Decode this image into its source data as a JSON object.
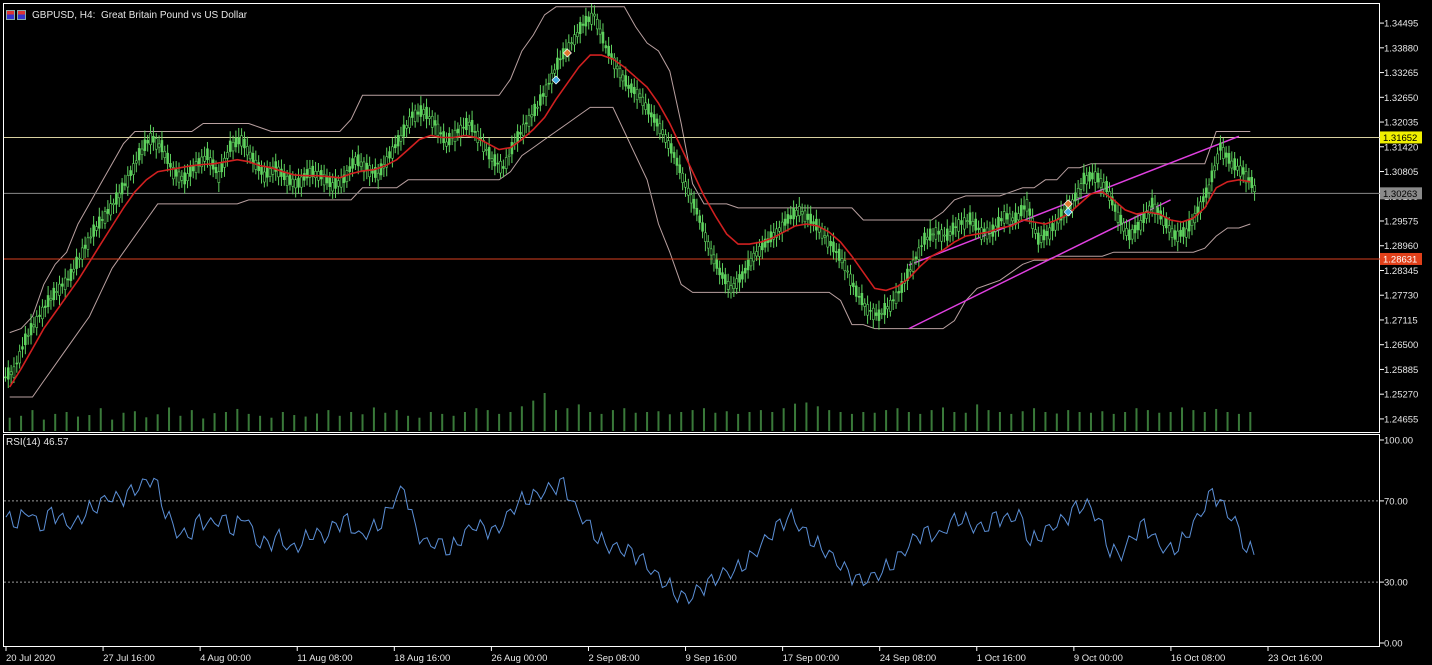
{
  "window": {
    "symbol": "GBPUSD",
    "timeframe": "H4",
    "description": "Great Britain Pound vs US Dollar",
    "icon_name": "chart-window-icon"
  },
  "colors": {
    "background": "#000000",
    "grid_frame": "#ffffff",
    "bull_candle": "#5fd35f",
    "bear_candle": "#5fd35f",
    "volume": "#3a7a3a",
    "ma": "#d02020",
    "channel": "#b9a0a0",
    "trendline": "#e040e0",
    "rsi": "#5b8fd6",
    "resistance": "#d8d0a0",
    "support": "#d84020",
    "current_price": "#8a8a8a"
  },
  "chart_data": {
    "type": "candlestick",
    "title": "GBPUSD, H4: Great Britain Pound vs US Dollar",
    "price_ticks": [
      "1.34495",
      "1.33880",
      "1.33265",
      "1.32650",
      "1.32035",
      "1.31420",
      "1.30805",
      "1.30190",
      "1.29575",
      "1.28960",
      "1.28345",
      "1.27730",
      "1.27115",
      "1.26500",
      "1.25885",
      "1.25270",
      "1.24655"
    ],
    "price_range": [
      1.2433,
      1.3487
    ],
    "time_labels": [
      "20 Jul 2020",
      "27 Jul 16:00",
      "4 Aug 00:00",
      "11 Aug 08:00",
      "18 Aug 16:00",
      "26 Aug 00:00",
      "2 Sep 08:00",
      "9 Sep 16:00",
      "17 Sep 00:00",
      "24 Sep 08:00",
      "1 Oct 16:00",
      "9 Oct 00:00",
      "16 Oct 08:00",
      "23 Oct 16:00"
    ],
    "close_series": [
      1.2585,
      1.266,
      1.271,
      1.2755,
      1.279,
      1.282,
      1.288,
      1.293,
      1.297,
      1.301,
      1.306,
      1.312,
      1.3165,
      1.314,
      1.308,
      1.306,
      1.3095,
      1.312,
      1.307,
      1.314,
      1.316,
      1.311,
      1.307,
      1.309,
      1.306,
      1.305,
      1.308,
      1.307,
      1.3045,
      1.306,
      1.311,
      1.309,
      1.307,
      1.312,
      1.3165,
      1.322,
      1.323,
      1.32,
      1.315,
      1.318,
      1.32,
      1.316,
      1.311,
      1.309,
      1.315,
      1.32,
      1.324,
      1.33,
      1.336,
      1.34,
      1.3445,
      1.347,
      1.339,
      1.334,
      1.329,
      1.327,
      1.322,
      1.318,
      1.312,
      1.305,
      1.298,
      1.29,
      1.283,
      1.279,
      1.282,
      1.287,
      1.29,
      1.293,
      1.296,
      1.2985,
      1.296,
      1.293,
      1.289,
      1.285,
      1.278,
      1.274,
      1.272,
      1.275,
      1.279,
      1.285,
      1.291,
      1.293,
      1.292,
      1.295,
      1.296,
      1.293,
      1.293,
      1.297,
      1.296,
      1.3,
      1.291,
      1.293,
      1.297,
      1.3,
      1.306,
      1.307,
      1.304,
      1.297,
      1.292,
      1.295,
      1.3,
      1.296,
      1.292,
      1.293,
      1.298,
      1.304,
      1.314,
      1.31,
      1.308,
      1.304
    ],
    "ma_series": [
      1.2545,
      1.259,
      1.264,
      1.269,
      1.273,
      1.277,
      1.281,
      1.2855,
      1.29,
      1.2945,
      1.299,
      1.303,
      1.306,
      1.308,
      1.3085,
      1.309,
      1.3095,
      1.3098,
      1.31,
      1.3105,
      1.311,
      1.3105,
      1.3095,
      1.309,
      1.308,
      1.3072,
      1.307,
      1.307,
      1.3068,
      1.3065,
      1.3075,
      1.3082,
      1.3085,
      1.3095,
      1.311,
      1.3135,
      1.316,
      1.317,
      1.3165,
      1.3165,
      1.317,
      1.3165,
      1.315,
      1.3135,
      1.314,
      1.316,
      1.3185,
      1.3215,
      1.326,
      1.33,
      1.334,
      1.337,
      1.337,
      1.336,
      1.334,
      1.3315,
      1.329,
      1.325,
      1.32,
      1.314,
      1.308,
      1.302,
      1.297,
      1.2925,
      1.29,
      1.29,
      1.2905,
      1.2915,
      1.293,
      1.2945,
      1.295,
      1.2945,
      1.293,
      1.2905,
      1.287,
      1.283,
      1.279,
      1.2785,
      1.2795,
      1.2815,
      1.2845,
      1.287,
      1.2885,
      1.2905,
      1.292,
      1.2925,
      1.293,
      1.294,
      1.2945,
      1.296,
      1.2955,
      1.295,
      1.296,
      1.2975,
      1.3,
      1.3025,
      1.303,
      1.301,
      1.2985,
      1.2975,
      1.298,
      1.2975,
      1.296,
      1.2955,
      1.2965,
      1.299,
      1.304,
      1.3055,
      1.306,
      1.3055
    ],
    "channel_upper": [
      1.268,
      1.269,
      1.272,
      1.28,
      1.285,
      1.288,
      1.295,
      1.3,
      1.305,
      1.31,
      1.315,
      1.318,
      1.318,
      1.318,
      1.318,
      1.318,
      1.318,
      1.32,
      1.32,
      1.32,
      1.32,
      1.32,
      1.319,
      1.318,
      1.318,
      1.318,
      1.318,
      1.318,
      1.318,
      1.318,
      1.321,
      1.327,
      1.327,
      1.327,
      1.327,
      1.327,
      1.327,
      1.327,
      1.327,
      1.327,
      1.327,
      1.327,
      1.327,
      1.327,
      1.331,
      1.338,
      1.342,
      1.347,
      1.349,
      1.349,
      1.349,
      1.349,
      1.349,
      1.349,
      1.349,
      1.344,
      1.34,
      1.338,
      1.333,
      1.32,
      1.305,
      1.3,
      1.3,
      1.3,
      1.299,
      1.299,
      1.299,
      1.299,
      1.299,
      1.299,
      1.299,
      1.299,
      1.299,
      1.299,
      1.299,
      1.296,
      1.296,
      1.296,
      1.296,
      1.296,
      1.296,
      1.296,
      1.298,
      1.301,
      1.302,
      1.302,
      1.302,
      1.302,
      1.303,
      1.304,
      1.304,
      1.306,
      1.306,
      1.309,
      1.309,
      1.31,
      1.31,
      1.31,
      1.31,
      1.31,
      1.31,
      1.31,
      1.31,
      1.31,
      1.31,
      1.31,
      1.318,
      1.318,
      1.318,
      1.318
    ],
    "channel_lower": [
      1.252,
      1.252,
      1.252,
      1.256,
      1.26,
      1.264,
      1.268,
      1.272,
      1.278,
      1.284,
      1.288,
      1.292,
      1.296,
      1.3,
      1.3,
      1.3,
      1.3,
      1.3,
      1.3,
      1.3,
      1.3,
      1.301,
      1.301,
      1.301,
      1.301,
      1.301,
      1.301,
      1.301,
      1.301,
      1.301,
      1.301,
      1.304,
      1.304,
      1.304,
      1.304,
      1.306,
      1.306,
      1.306,
      1.306,
      1.306,
      1.306,
      1.306,
      1.306,
      1.306,
      1.308,
      1.312,
      1.314,
      1.316,
      1.318,
      1.32,
      1.322,
      1.324,
      1.324,
      1.324,
      1.318,
      1.312,
      1.306,
      1.295,
      1.288,
      1.28,
      1.278,
      1.278,
      1.278,
      1.278,
      1.278,
      1.278,
      1.278,
      1.278,
      1.278,
      1.278,
      1.278,
      1.278,
      1.278,
      1.276,
      1.27,
      1.27,
      1.269,
      1.269,
      1.269,
      1.269,
      1.269,
      1.269,
      1.269,
      1.271,
      1.276,
      1.279,
      1.28,
      1.281,
      1.283,
      1.285,
      1.286,
      1.286,
      1.287,
      1.287,
      1.287,
      1.287,
      1.287,
      1.288,
      1.288,
      1.288,
      1.288,
      1.288,
      1.288,
      1.288,
      1.288,
      1.289,
      1.292,
      1.294,
      1.294,
      1.295
    ],
    "levels": {
      "resistance": "1.31652",
      "current": "1.30263",
      "support": "1.28631"
    },
    "price_values": {
      "resistance": 1.31652,
      "current": 1.30263,
      "support": 1.28631
    },
    "volume_series": [
      0.35,
      0.4,
      0.55,
      0.3,
      0.45,
      0.5,
      0.38,
      0.42,
      0.6,
      0.3,
      0.48,
      0.52,
      0.36,
      0.44,
      0.62,
      0.4,
      0.55,
      0.33,
      0.47,
      0.5,
      0.58,
      0.45,
      0.4,
      0.35,
      0.5,
      0.42,
      0.38,
      0.46,
      0.55,
      0.4,
      0.5,
      0.44,
      0.62,
      0.48,
      0.55,
      0.4,
      0.35,
      0.5,
      0.45,
      0.4,
      0.5,
      0.6,
      0.55,
      0.45,
      0.5,
      0.65,
      0.8,
      1.0,
      0.55,
      0.6,
      0.7,
      0.5,
      0.45,
      0.55,
      0.6,
      0.48,
      0.5,
      0.52,
      0.44,
      0.5,
      0.55,
      0.6,
      0.48,
      0.52,
      0.45,
      0.5,
      0.55,
      0.5,
      0.6,
      0.72,
      0.75,
      0.65,
      0.55,
      0.5,
      0.45,
      0.5,
      0.48,
      0.55,
      0.6,
      0.5,
      0.45,
      0.55,
      0.62,
      0.5,
      0.48,
      0.7,
      0.55,
      0.5,
      0.45,
      0.52,
      0.6,
      0.5,
      0.46,
      0.55,
      0.5,
      0.48,
      0.52,
      0.45,
      0.5,
      0.6,
      0.55,
      0.48,
      0.5,
      0.62,
      0.55,
      0.5,
      0.58,
      0.5,
      0.45,
      0.5
    ],
    "rsi": {
      "label": "RSI(14)",
      "value": "46.57",
      "ticks": [
        "100.00",
        "70.00",
        "30.00",
        "0.00"
      ],
      "levels": [
        70,
        30
      ],
      "series": [
        62,
        60,
        66,
        56,
        64,
        60,
        58,
        65,
        68,
        72,
        70,
        74,
        78,
        82,
        65,
        55,
        52,
        60,
        58,
        62,
        56,
        64,
        50,
        48,
        52,
        46,
        50,
        55,
        52,
        58,
        60,
        52,
        56,
        60,
        70,
        76,
        55,
        48,
        50,
        46,
        52,
        58,
        56,
        54,
        62,
        70,
        72,
        74,
        76,
        78,
        66,
        60,
        52,
        48,
        46,
        44,
        40,
        34,
        30,
        24,
        22,
        26,
        30,
        34,
        36,
        40,
        46,
        52,
        58,
        62,
        56,
        50,
        46,
        40,
        34,
        30,
        32,
        36,
        40,
        46,
        52,
        54,
        52,
        60,
        62,
        58,
        56,
        62,
        60,
        64,
        50,
        54,
        58,
        60,
        66,
        68,
        62,
        46,
        44,
        52,
        58,
        50,
        46,
        48,
        56,
        64,
        74,
        66,
        60,
        46
      ]
    }
  }
}
